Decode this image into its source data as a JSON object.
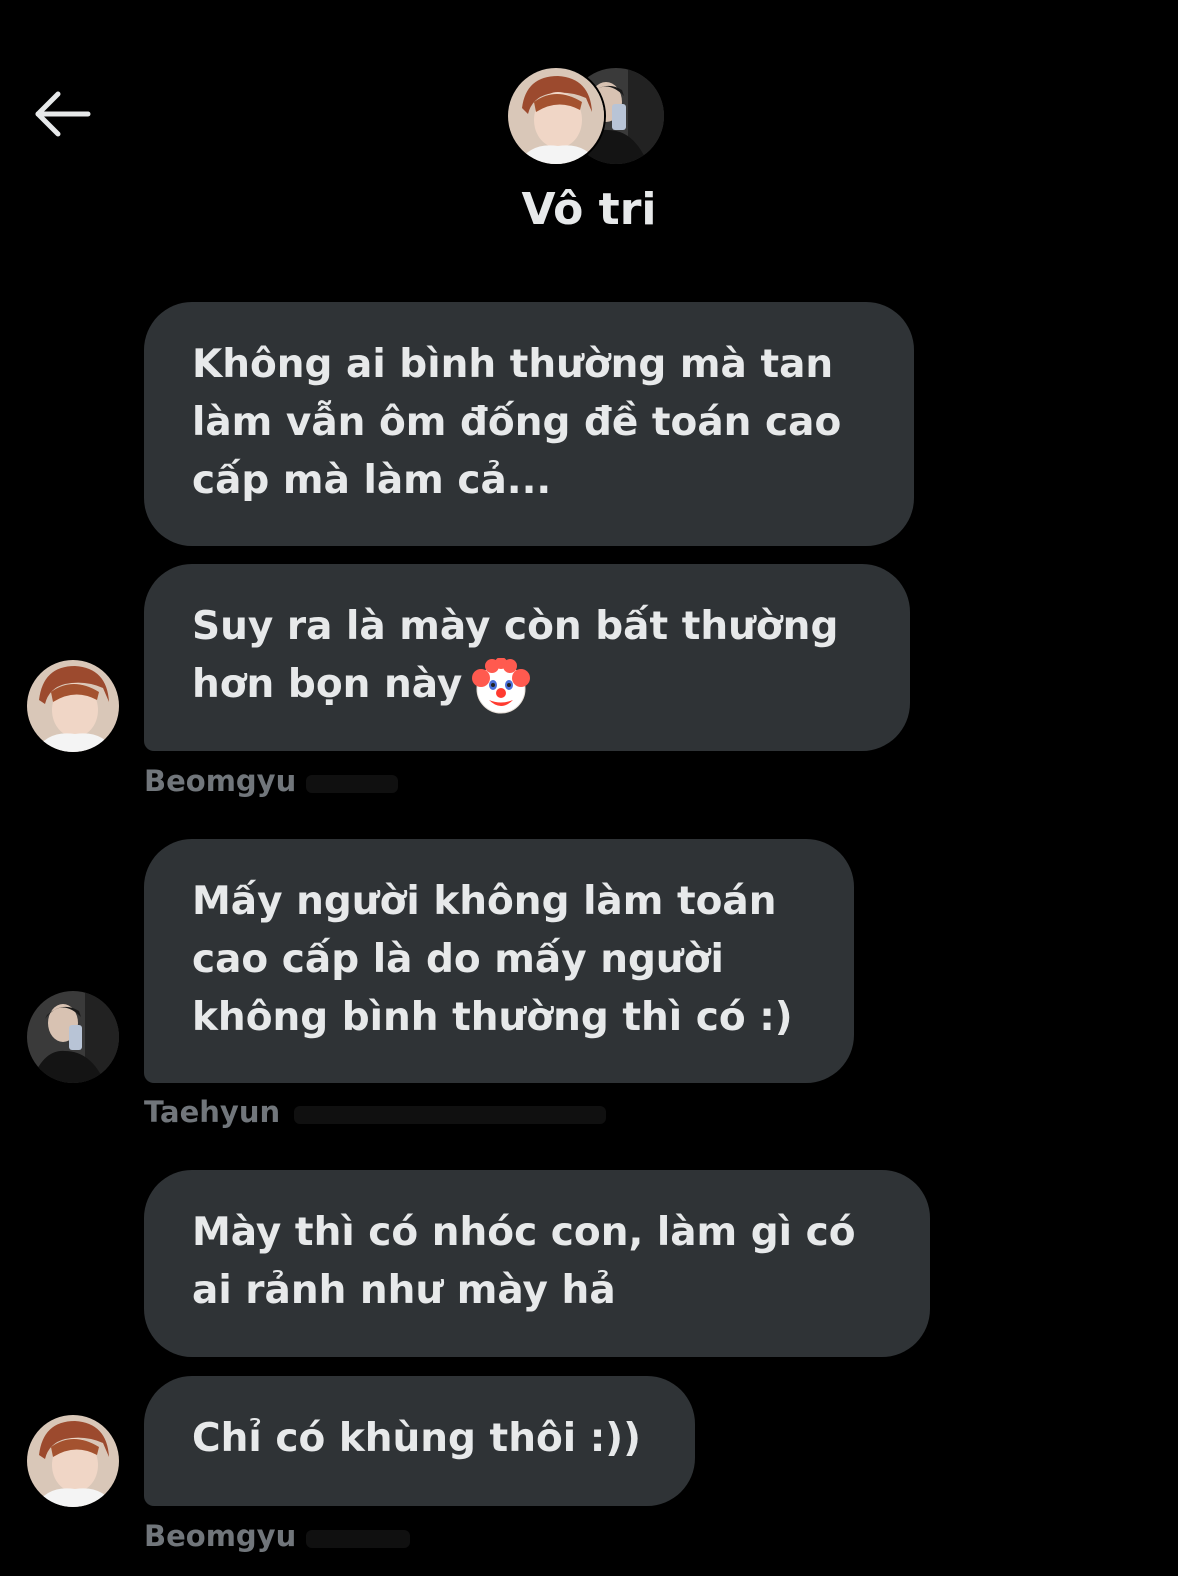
{
  "header": {
    "back_icon": "arrow-left-icon",
    "title": "Vô tri"
  },
  "messages": [
    {
      "text": "Không ai bình thường mà tan làm vẫn ôm đống đề toán cao cấp mà làm cả..."
    },
    {
      "text": "Suy ra là mày còn bất thường hơn bọn này",
      "emoji": "clown-face-icon"
    },
    {
      "sender": "Beomgyu"
    },
    {
      "text": "Mấy người không làm toán cao cấp là do mấy người không bình thường thì có :)"
    },
    {
      "sender": "Taehyun"
    },
    {
      "text": "Mày thì có nhóc con, làm gì có ai rảnh như mày hả"
    },
    {
      "text": "Chỉ có khùng thôi :))"
    },
    {
      "sender": "Beomgyu"
    }
  ],
  "colors": {
    "background": "#000000",
    "bubble": "#2f3336",
    "text": "#e7e9ea",
    "secondary_text": "#71767b"
  }
}
